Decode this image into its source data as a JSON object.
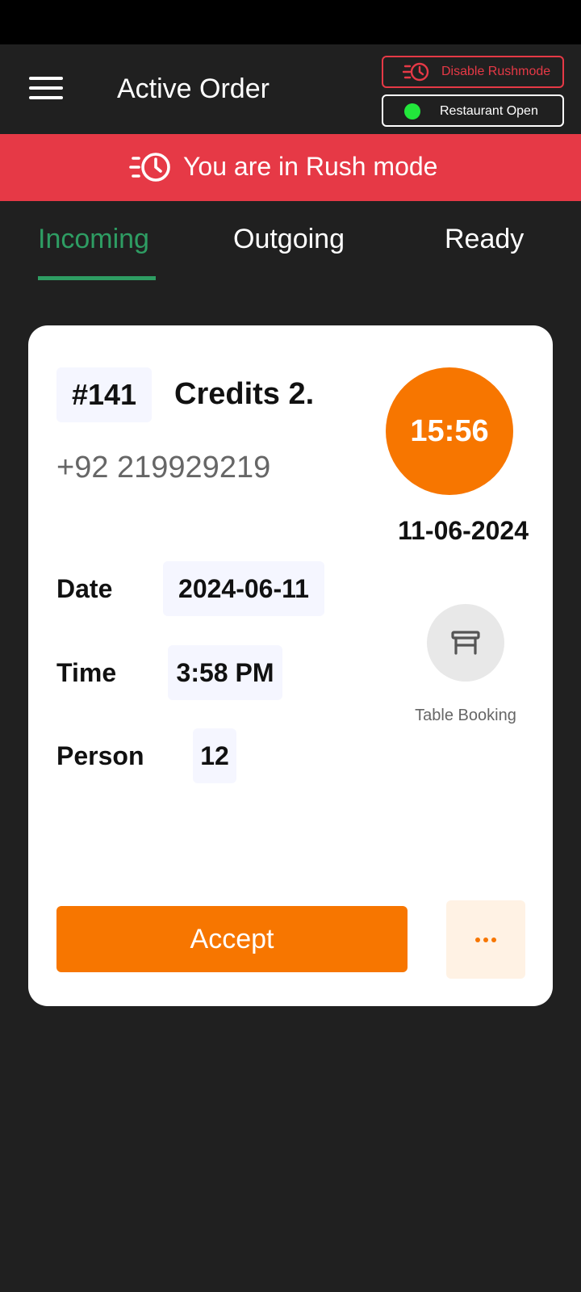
{
  "header": {
    "title": "Active Order",
    "rush_toggle_label": "Disable Rushmode",
    "restaurant_status_label": "Restaurant Open"
  },
  "banner": {
    "text": "You are in Rush mode"
  },
  "tabs": [
    {
      "label": "Incoming",
      "active": true
    },
    {
      "label": "Outgoing",
      "active": false
    },
    {
      "label": "Ready",
      "active": false
    }
  ],
  "order": {
    "number": "#141",
    "customer_name": "Credits 2.",
    "phone": "+92 219929219",
    "timer": "15:56",
    "order_date": "11-06-2024",
    "fields": {
      "date_label": "Date",
      "date_value": "2024-06-11",
      "time_label": "Time",
      "time_value": "3:58 PM",
      "person_label": "Person",
      "person_value": "12"
    },
    "type_label": "Table Booking",
    "type_icon": "table-icon",
    "accept_label": "Accept",
    "more_icon": "more-dots-icon"
  },
  "colors": {
    "background": "#202020",
    "rush_red": "#e63946",
    "active_tab_green": "#2e9d63",
    "accent_orange": "#f77600",
    "status_open_green": "#22e73b"
  }
}
